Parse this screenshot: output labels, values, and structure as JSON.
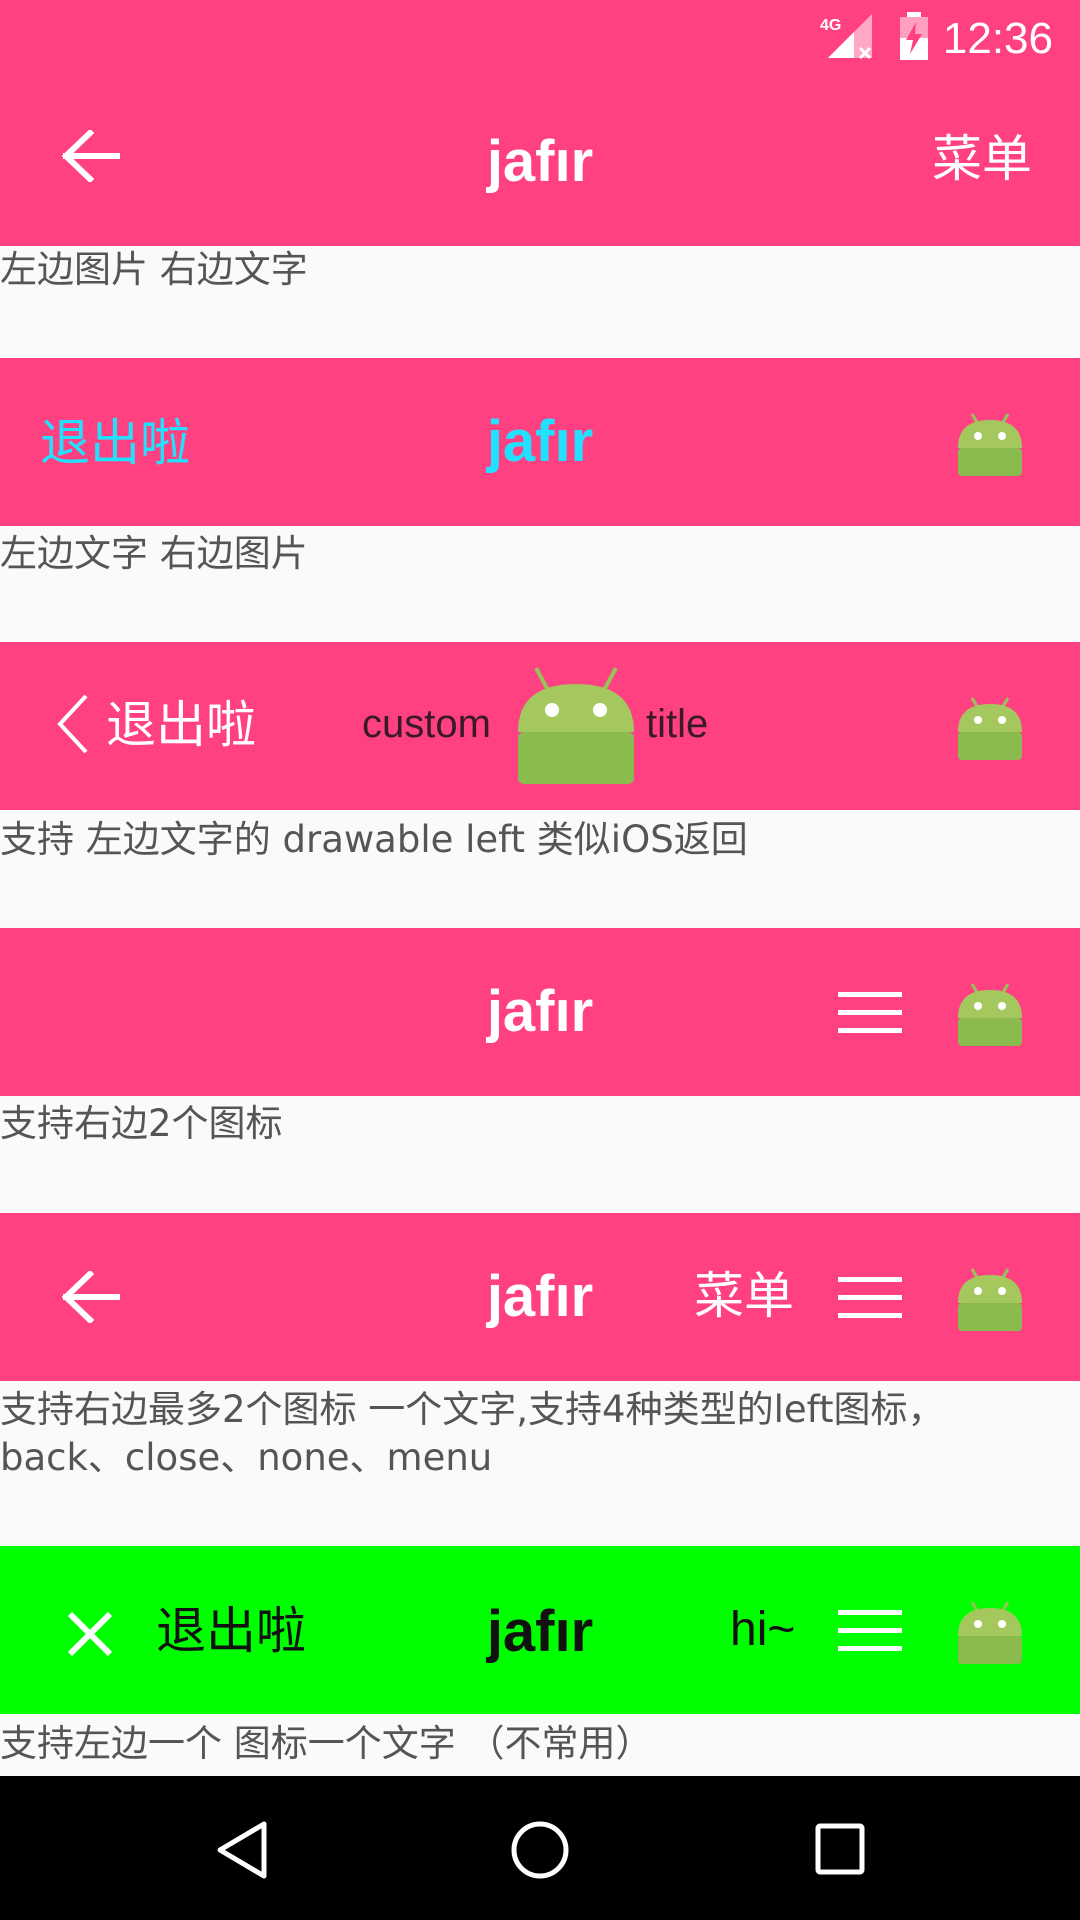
{
  "status_bar": {
    "time": "12:36",
    "network": "4G"
  },
  "bars": [
    {
      "title": "jafır",
      "right_text": "菜单",
      "left_icon": "arrow-back-icon",
      "background": "#ff4081"
    },
    {
      "title": "jafır",
      "left_text": "退出啦",
      "right_icon": "android-icon",
      "text_color": "#22e1ff"
    },
    {
      "custom_title_left": "custom",
      "custom_title_right": "title",
      "left_text": "退出啦",
      "left_icon": "chevron-left-icon",
      "right_icon": "android-icon"
    },
    {
      "title": "jafır",
      "right_icons": [
        "menu-icon",
        "android-icon"
      ]
    },
    {
      "title": "jafır",
      "left_icon": "arrow-back-icon",
      "right_text": "菜单",
      "right_icons": [
        "menu-icon",
        "android-icon"
      ]
    },
    {
      "title": "jafır",
      "left_icon": "close-icon",
      "left_text": "退出啦",
      "right_text": "hi~",
      "right_icons": [
        "menu-icon",
        "android-icon"
      ],
      "background": "#00ff00"
    }
  ],
  "captions": [
    "左边图片  右边文字",
    "左边文字 右边图片",
    "支持 左边文字的 drawable left  类似iOS返回",
    "支持右边2个图标",
    "支持右边最多2个图标 一个文字,支持4种类型的left图标，back、close、none、menu",
    "支持左边一个 图标一个文字   （不常用）"
  ],
  "nav_bar": {
    "buttons": [
      "back-icon",
      "home-icon",
      "recents-icon"
    ]
  }
}
